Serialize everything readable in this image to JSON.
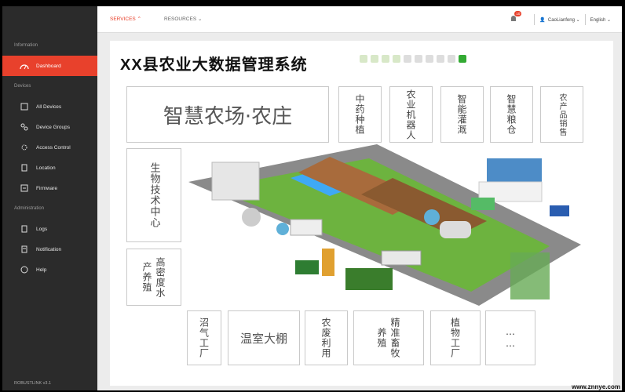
{
  "sidebar": {
    "section_information": "Information",
    "dashboard": "Dashboard",
    "section_devices": "Devices",
    "all_devices": "All Devices",
    "device_groups": "Device Groups",
    "access_control": "Access Control",
    "location": "Location",
    "firmware": "Firmware",
    "section_administration": "Administration",
    "logs": "Logs",
    "notification": "Notification",
    "help": "Help",
    "footer": "ROBUSTLINK v3.1"
  },
  "topbar": {
    "services": "SERVICES ⌃",
    "resources": "RESOURCES ⌄",
    "notification_count": "10",
    "user": "CaoLianfeng ⌄",
    "language": "English ⌄"
  },
  "page": {
    "title": "XX县农业大数据管理系统",
    "main_card": "智慧农场·农庄",
    "cards_top": [
      "中药种植",
      "农业机器人",
      "智能灌溉",
      "智慧粮仓",
      "农产品销售"
    ],
    "card_bio": "生物技术中心",
    "card_fish": "高密度水产养殖",
    "card_biogas": "沼气工厂",
    "card_greenhouse": "温室大棚",
    "card_waste": "农废利用",
    "card_livestock": "精准畜牧养殖",
    "card_plant": "植物工厂",
    "card_more": "……",
    "watermark": "www.znnye.com"
  },
  "colors": {
    "accent": "#e8412c",
    "sidebar": "#2b2b2b"
  }
}
